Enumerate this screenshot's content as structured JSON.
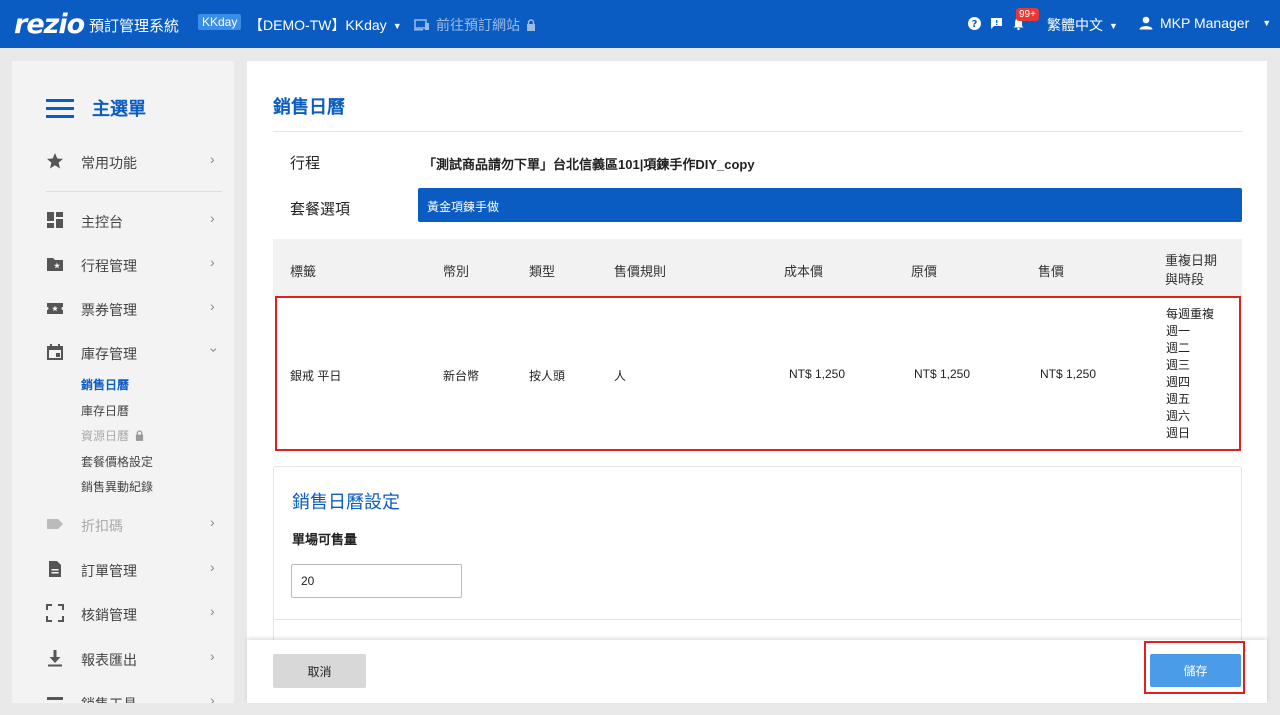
{
  "topbar": {
    "logo": "rezio",
    "app_title": "預訂管理系統",
    "brand_badge": "KKday",
    "account": "【DEMO-TW】KKday",
    "booking_site": "前往預訂網站",
    "notification_count": "99+",
    "language": "繁體中文",
    "user": "MKP Manager",
    "brand_color": "#0b5cc2"
  },
  "sidebar": {
    "title": "主選單",
    "items": [
      {
        "label": "常用功能",
        "icon": "star-icon"
      },
      {
        "label": "主控台",
        "icon": "dashboard-icon"
      },
      {
        "label": "行程管理",
        "icon": "folder-star-icon"
      },
      {
        "label": "票券管理",
        "icon": "ticket-icon"
      },
      {
        "label": "庫存管理",
        "icon": "calendar-icon"
      },
      {
        "label": "折扣碼",
        "icon": "tag-icon"
      },
      {
        "label": "訂單管理",
        "icon": "document-icon"
      },
      {
        "label": "核銷管理",
        "icon": "scan-icon"
      },
      {
        "label": "報表匯出",
        "icon": "download-icon"
      },
      {
        "label": "銷售工具",
        "icon": "tools-icon"
      }
    ],
    "inventory_sub": [
      {
        "label": "銷售日曆",
        "state": "active"
      },
      {
        "label": "庫存日曆",
        "state": "normal"
      },
      {
        "label": "資源日曆",
        "state": "locked"
      },
      {
        "label": "套餐價格設定",
        "state": "normal"
      },
      {
        "label": "銷售異動紀錄",
        "state": "normal"
      }
    ]
  },
  "main": {
    "page_title": "銷售日曆",
    "itinerary_label": "行程",
    "itinerary_value": "「測試商品請勿下單」台北信義區101|項鍊手作DIY_copy",
    "package_label": "套餐選項",
    "package_value": "黃金項鍊手做",
    "table": {
      "headers": [
        "標籤",
        "幣別",
        "類型",
        "售價規則",
        "成本價",
        "原價",
        "售價",
        "重複日期",
        "與時段"
      ],
      "row": {
        "tag": "銀戒 平日",
        "currency": "新台幣",
        "type": "按人頭",
        "price_rule": "人",
        "cost": "NT$ 1,250",
        "original": "NT$ 1,250",
        "sale": "NT$ 1,250",
        "repeat": [
          "每週重複",
          "週一",
          "週二",
          "週三",
          "週四",
          "週五",
          "週六",
          "週日"
        ]
      }
    },
    "settings": {
      "title": "銷售日曆設定",
      "qty_label": "單場可售量",
      "qty_value": "20"
    }
  },
  "footer": {
    "cancel_label": "取消",
    "save_label": "儲存"
  }
}
